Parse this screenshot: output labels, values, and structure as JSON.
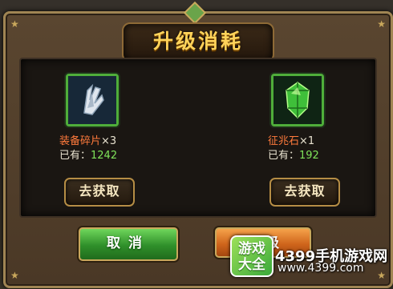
{
  "dialog": {
    "title": "升级消耗",
    "items": [
      {
        "icon": "equipment-fragment-icon",
        "name": "装备碎片",
        "qty": "×3",
        "owned_label": "已有：",
        "owned_value": "1242",
        "get_label": "去获取"
      },
      {
        "icon": "sign-stone-icon",
        "name": "征兆石",
        "qty": "×1",
        "owned_label": "已有：",
        "owned_value": "192",
        "get_label": "去获取"
      }
    ],
    "cancel_label": "取消",
    "upgrade_label": "升级"
  },
  "watermark": {
    "logo": "游戏大全",
    "site": "4399手机游戏网",
    "url": "www.4399.com"
  },
  "colors": {
    "item_name": "#ff7a3c",
    "owned_value": "#7fe35a",
    "title": "#ffd35a",
    "cancel": "#2f8f2a",
    "upgrade": "#d0661c"
  }
}
